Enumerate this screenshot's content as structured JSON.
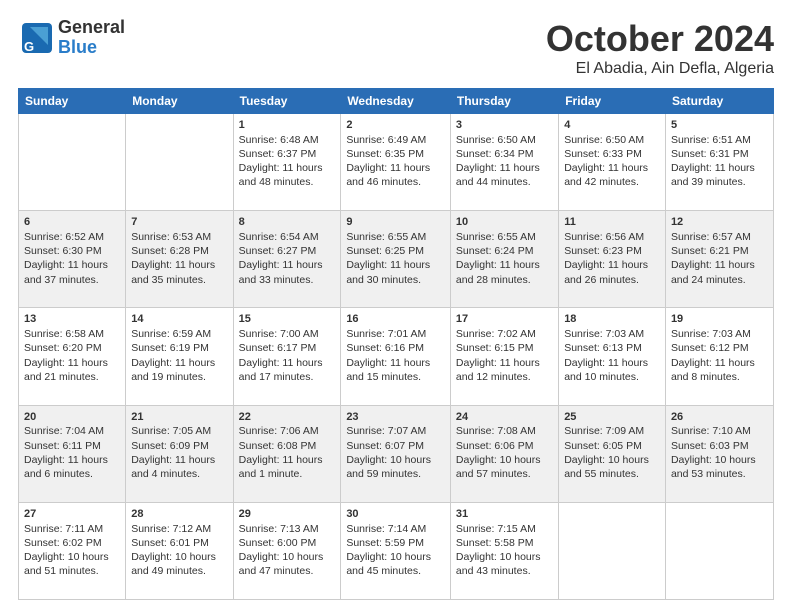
{
  "header": {
    "logo_general": "General",
    "logo_blue": "Blue",
    "month_title": "October 2024",
    "location": "El Abadia, Ain Defla, Algeria"
  },
  "days_of_week": [
    "Sunday",
    "Monday",
    "Tuesday",
    "Wednesday",
    "Thursday",
    "Friday",
    "Saturday"
  ],
  "weeks": [
    [
      {
        "day": "",
        "content": ""
      },
      {
        "day": "",
        "content": ""
      },
      {
        "day": "1",
        "content": "Sunrise: 6:48 AM\nSunset: 6:37 PM\nDaylight: 11 hours and 48 minutes."
      },
      {
        "day": "2",
        "content": "Sunrise: 6:49 AM\nSunset: 6:35 PM\nDaylight: 11 hours and 46 minutes."
      },
      {
        "day": "3",
        "content": "Sunrise: 6:50 AM\nSunset: 6:34 PM\nDaylight: 11 hours and 44 minutes."
      },
      {
        "day": "4",
        "content": "Sunrise: 6:50 AM\nSunset: 6:33 PM\nDaylight: 11 hours and 42 minutes."
      },
      {
        "day": "5",
        "content": "Sunrise: 6:51 AM\nSunset: 6:31 PM\nDaylight: 11 hours and 39 minutes."
      }
    ],
    [
      {
        "day": "6",
        "content": "Sunrise: 6:52 AM\nSunset: 6:30 PM\nDaylight: 11 hours and 37 minutes."
      },
      {
        "day": "7",
        "content": "Sunrise: 6:53 AM\nSunset: 6:28 PM\nDaylight: 11 hours and 35 minutes."
      },
      {
        "day": "8",
        "content": "Sunrise: 6:54 AM\nSunset: 6:27 PM\nDaylight: 11 hours and 33 minutes."
      },
      {
        "day": "9",
        "content": "Sunrise: 6:55 AM\nSunset: 6:25 PM\nDaylight: 11 hours and 30 minutes."
      },
      {
        "day": "10",
        "content": "Sunrise: 6:55 AM\nSunset: 6:24 PM\nDaylight: 11 hours and 28 minutes."
      },
      {
        "day": "11",
        "content": "Sunrise: 6:56 AM\nSunset: 6:23 PM\nDaylight: 11 hours and 26 minutes."
      },
      {
        "day": "12",
        "content": "Sunrise: 6:57 AM\nSunset: 6:21 PM\nDaylight: 11 hours and 24 minutes."
      }
    ],
    [
      {
        "day": "13",
        "content": "Sunrise: 6:58 AM\nSunset: 6:20 PM\nDaylight: 11 hours and 21 minutes."
      },
      {
        "day": "14",
        "content": "Sunrise: 6:59 AM\nSunset: 6:19 PM\nDaylight: 11 hours and 19 minutes."
      },
      {
        "day": "15",
        "content": "Sunrise: 7:00 AM\nSunset: 6:17 PM\nDaylight: 11 hours and 17 minutes."
      },
      {
        "day": "16",
        "content": "Sunrise: 7:01 AM\nSunset: 6:16 PM\nDaylight: 11 hours and 15 minutes."
      },
      {
        "day": "17",
        "content": "Sunrise: 7:02 AM\nSunset: 6:15 PM\nDaylight: 11 hours and 12 minutes."
      },
      {
        "day": "18",
        "content": "Sunrise: 7:03 AM\nSunset: 6:13 PM\nDaylight: 11 hours and 10 minutes."
      },
      {
        "day": "19",
        "content": "Sunrise: 7:03 AM\nSunset: 6:12 PM\nDaylight: 11 hours and 8 minutes."
      }
    ],
    [
      {
        "day": "20",
        "content": "Sunrise: 7:04 AM\nSunset: 6:11 PM\nDaylight: 11 hours and 6 minutes."
      },
      {
        "day": "21",
        "content": "Sunrise: 7:05 AM\nSunset: 6:09 PM\nDaylight: 11 hours and 4 minutes."
      },
      {
        "day": "22",
        "content": "Sunrise: 7:06 AM\nSunset: 6:08 PM\nDaylight: 11 hours and 1 minute."
      },
      {
        "day": "23",
        "content": "Sunrise: 7:07 AM\nSunset: 6:07 PM\nDaylight: 10 hours and 59 minutes."
      },
      {
        "day": "24",
        "content": "Sunrise: 7:08 AM\nSunset: 6:06 PM\nDaylight: 10 hours and 57 minutes."
      },
      {
        "day": "25",
        "content": "Sunrise: 7:09 AM\nSunset: 6:05 PM\nDaylight: 10 hours and 55 minutes."
      },
      {
        "day": "26",
        "content": "Sunrise: 7:10 AM\nSunset: 6:03 PM\nDaylight: 10 hours and 53 minutes."
      }
    ],
    [
      {
        "day": "27",
        "content": "Sunrise: 7:11 AM\nSunset: 6:02 PM\nDaylight: 10 hours and 51 minutes."
      },
      {
        "day": "28",
        "content": "Sunrise: 7:12 AM\nSunset: 6:01 PM\nDaylight: 10 hours and 49 minutes."
      },
      {
        "day": "29",
        "content": "Sunrise: 7:13 AM\nSunset: 6:00 PM\nDaylight: 10 hours and 47 minutes."
      },
      {
        "day": "30",
        "content": "Sunrise: 7:14 AM\nSunset: 5:59 PM\nDaylight: 10 hours and 45 minutes."
      },
      {
        "day": "31",
        "content": "Sunrise: 7:15 AM\nSunset: 5:58 PM\nDaylight: 10 hours and 43 minutes."
      },
      {
        "day": "",
        "content": ""
      },
      {
        "day": "",
        "content": ""
      }
    ]
  ]
}
